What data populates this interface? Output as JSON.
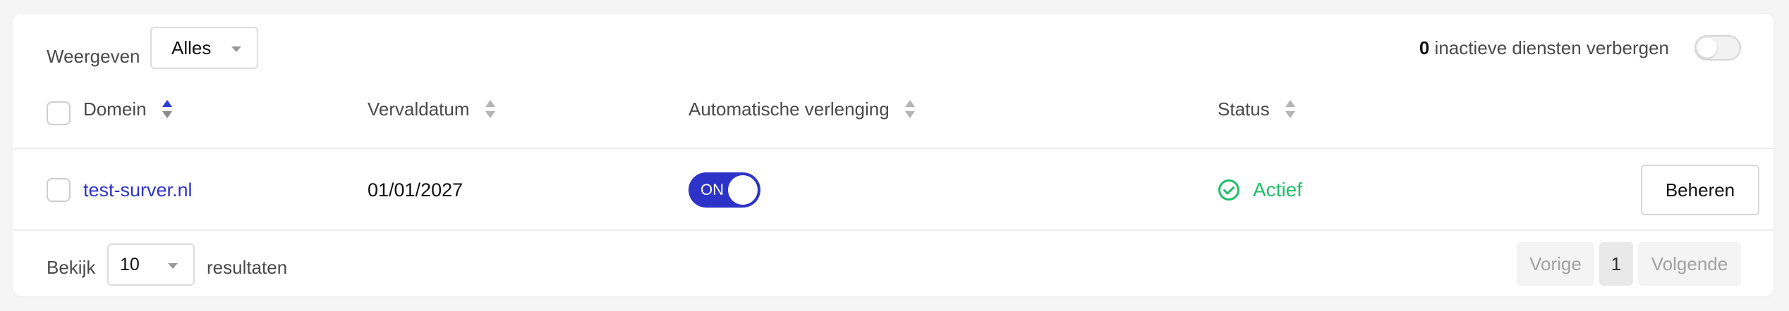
{
  "filter": {
    "label": "Weergeven",
    "selected": "Alles"
  },
  "inactive": {
    "count": "0",
    "text": "inactieve diensten verbergen",
    "enabled": false
  },
  "table": {
    "columns": {
      "domain": "Domein",
      "expiry": "Vervaldatum",
      "auto_renew": "Automatische verlenging",
      "status": "Status"
    },
    "rows": [
      {
        "domain": "test-surver.nl",
        "expiry": "01/01/2027",
        "auto_renew": "ON",
        "status": "Actief",
        "action": "Beheren"
      }
    ]
  },
  "footer": {
    "show_label": "Bekijk",
    "page_size": "10",
    "results_label": "resultaten",
    "prev": "Vorige",
    "current_page": "1",
    "next": "Volgende"
  },
  "colors": {
    "accent": "#2d33c6",
    "link": "#2f34c8",
    "status_active": "#1fbf6a"
  }
}
